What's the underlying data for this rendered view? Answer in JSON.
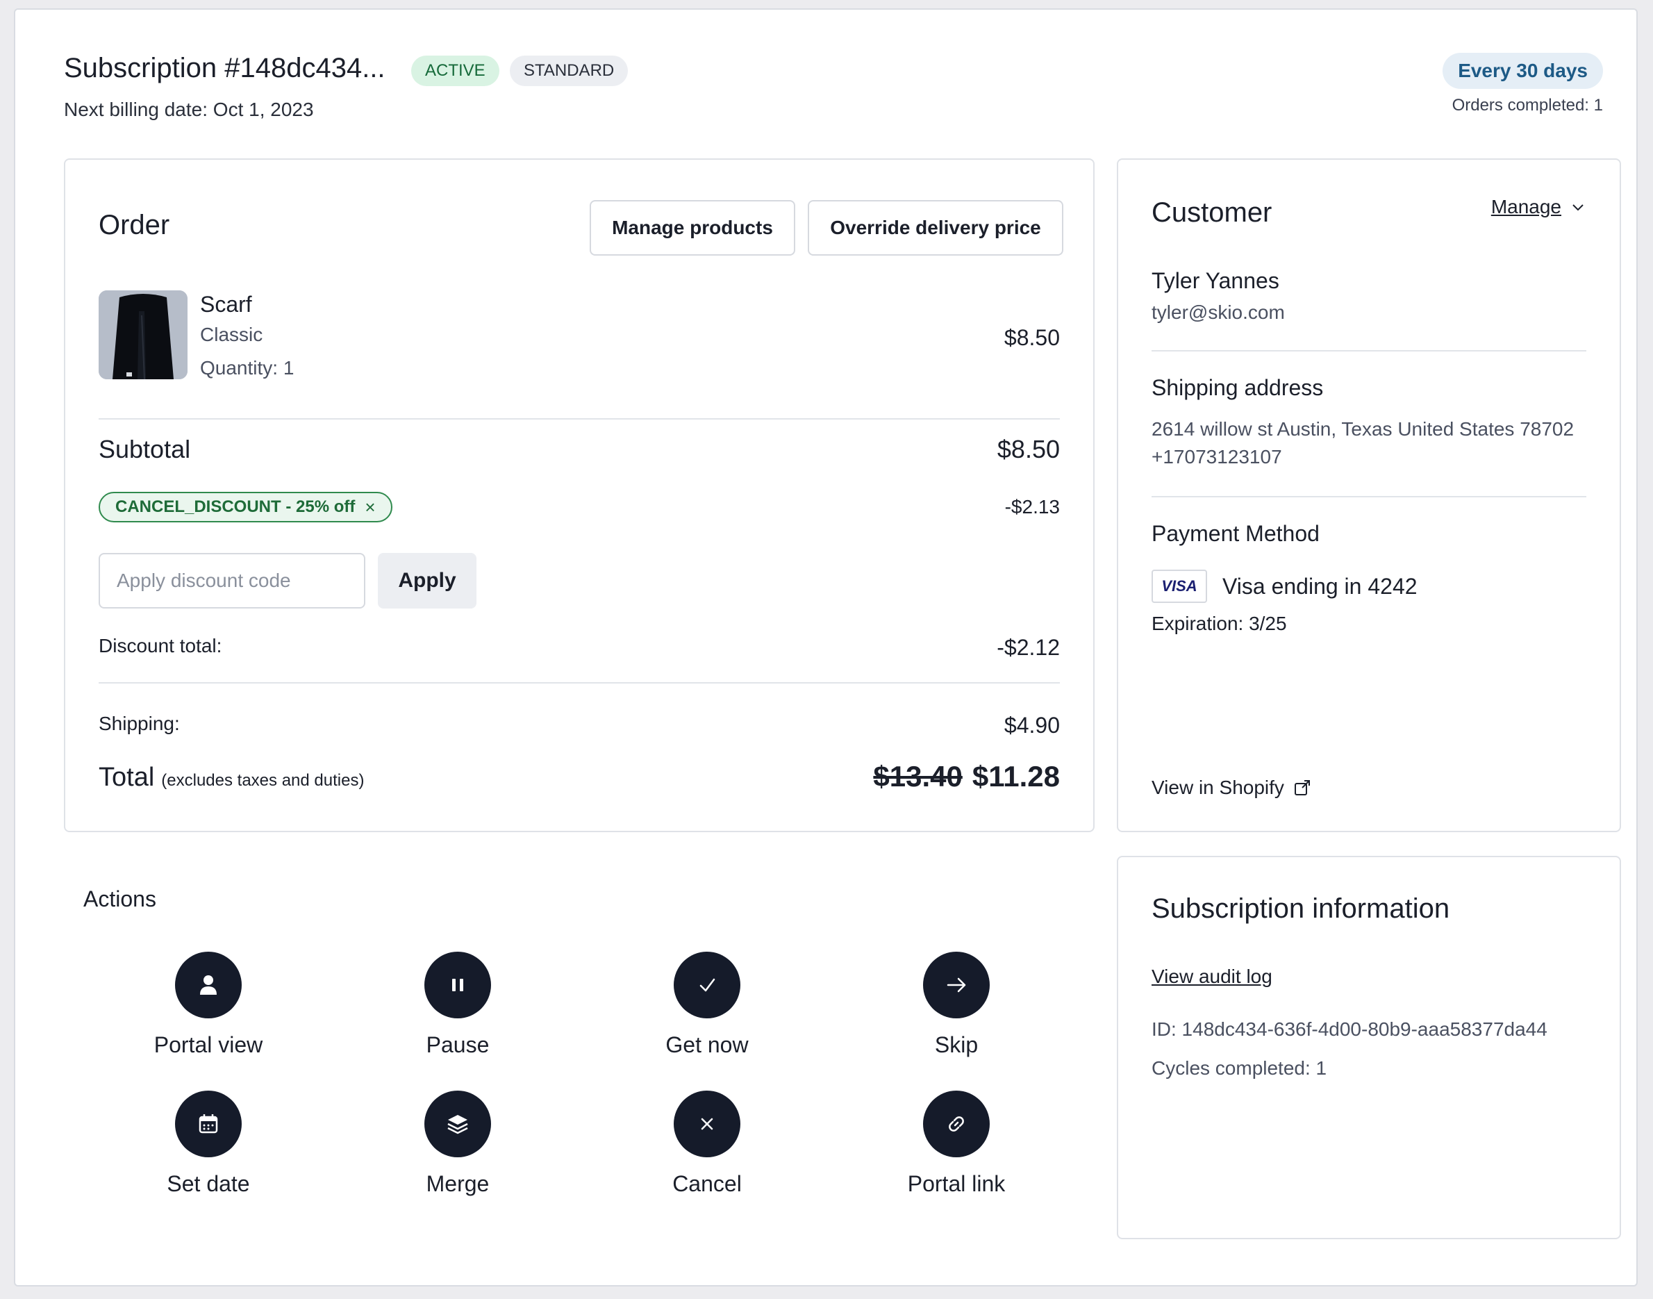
{
  "header": {
    "title": "Subscription #148dc434...",
    "status_badge": "ACTIVE",
    "type_badge": "STANDARD",
    "next_billing": "Next billing date: Oct 1, 2023",
    "frequency": "Every 30 days",
    "orders_completed": "Orders completed: 1"
  },
  "order": {
    "title": "Order",
    "manage_products": "Manage products",
    "override_delivery": "Override delivery price",
    "product": {
      "name": "Scarf",
      "variant": "Classic",
      "quantity": "Quantity: 1",
      "price": "$8.50"
    },
    "subtotal_label": "Subtotal",
    "subtotal_value": "$8.50",
    "discount_code": "CANCEL_DISCOUNT - 25% off",
    "discount_code_amount": "-$2.13",
    "discount_input_placeholder": "Apply discount code",
    "apply_label": "Apply",
    "discount_total_label": "Discount total:",
    "discount_total_value": "-$2.12",
    "shipping_label": "Shipping:",
    "shipping_value": "$4.90",
    "total_label": "Total",
    "total_note": "(excludes taxes and duties)",
    "total_original": "$13.40",
    "total_value": "$11.28"
  },
  "actions": {
    "title": "Actions",
    "items": [
      {
        "label": "Portal view",
        "icon": "person-icon"
      },
      {
        "label": "Pause",
        "icon": "pause-icon"
      },
      {
        "label": "Get now",
        "icon": "check-icon"
      },
      {
        "label": "Skip",
        "icon": "arrow-right-icon"
      },
      {
        "label": "Set date",
        "icon": "calendar-icon"
      },
      {
        "label": "Merge",
        "icon": "layers-icon"
      },
      {
        "label": "Cancel",
        "icon": "close-icon"
      },
      {
        "label": "Portal link",
        "icon": "link-icon"
      }
    ]
  },
  "customer": {
    "title": "Customer",
    "manage_label": "Manage",
    "name": "Tyler Yannes",
    "email": "tyler@skio.com",
    "shipping_title": "Shipping address",
    "address": "2614 willow st Austin, Texas United States 78702",
    "phone": "+17073123107",
    "payment_title": "Payment Method",
    "card_brand": "VISA",
    "card_text": "Visa ending in 4242",
    "expiration": "Expiration: 3/25",
    "view_shopify": "View in Shopify"
  },
  "subscription_info": {
    "title": "Subscription information",
    "audit_log": "View audit log",
    "id": "ID: 148dc434-636f-4d00-80b9-aaa58377da44",
    "cycles": "Cycles completed: 1"
  },
  "colors": {
    "dark_button": "#151b2a",
    "active_badge_bg": "#d9f3e3",
    "active_badge_text": "#166a3a",
    "frequency_bg": "#e5eef6",
    "frequency_text": "#1d5a86",
    "discount_tag_border": "#2f8a4d"
  }
}
